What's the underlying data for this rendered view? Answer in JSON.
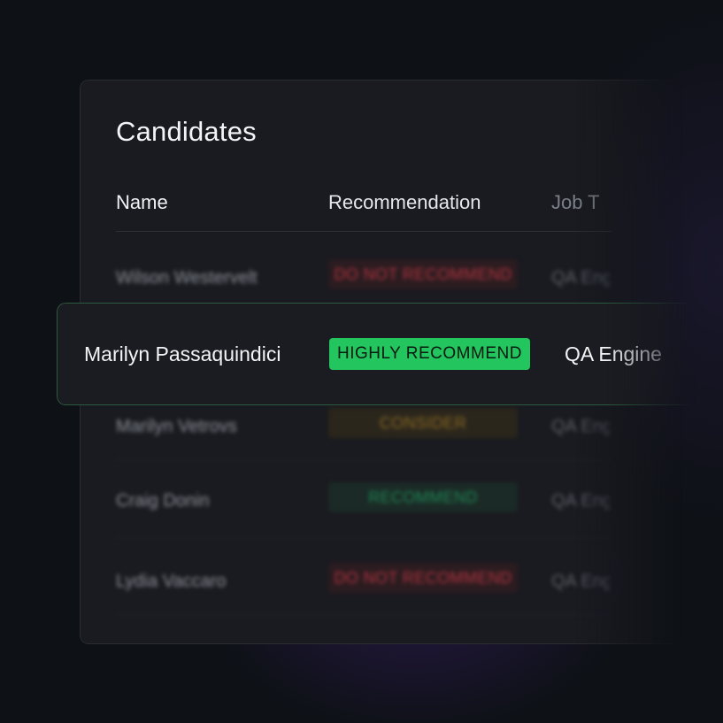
{
  "table": {
    "title": "Candidates",
    "columns": {
      "name": "Name",
      "recommendation": "Recommendation",
      "job_title": "Job T"
    },
    "rows": [
      {
        "name": "Wilson Westervelt",
        "recommendation": "DO NOT RECOMMEND",
        "job": "QA Eng",
        "status": "red"
      },
      {
        "name": "Marilyn Vetrovs",
        "recommendation": "CONSIDER",
        "job": "QA Eng",
        "status": "amber"
      },
      {
        "name": "Craig Donin",
        "recommendation": "RECOMMEND",
        "job": "QA Eng",
        "status": "green"
      },
      {
        "name": "Lydia Vaccaro",
        "recommendation": "DO NOT RECOMMEND",
        "job": "QA Eng",
        "status": "red"
      }
    ]
  },
  "highlighted_row": {
    "name": "Marilyn Passaquindici",
    "recommendation": "HIGHLY RECOMMEND",
    "job": "QA Engine"
  },
  "colors": {
    "background": "#0e1116",
    "panel": "#1a1b20",
    "highly_recommend": "#22c55e",
    "recommend": "#1e8a56",
    "consider": "#8c6a23",
    "do_not_recommend": "#b3343f"
  }
}
